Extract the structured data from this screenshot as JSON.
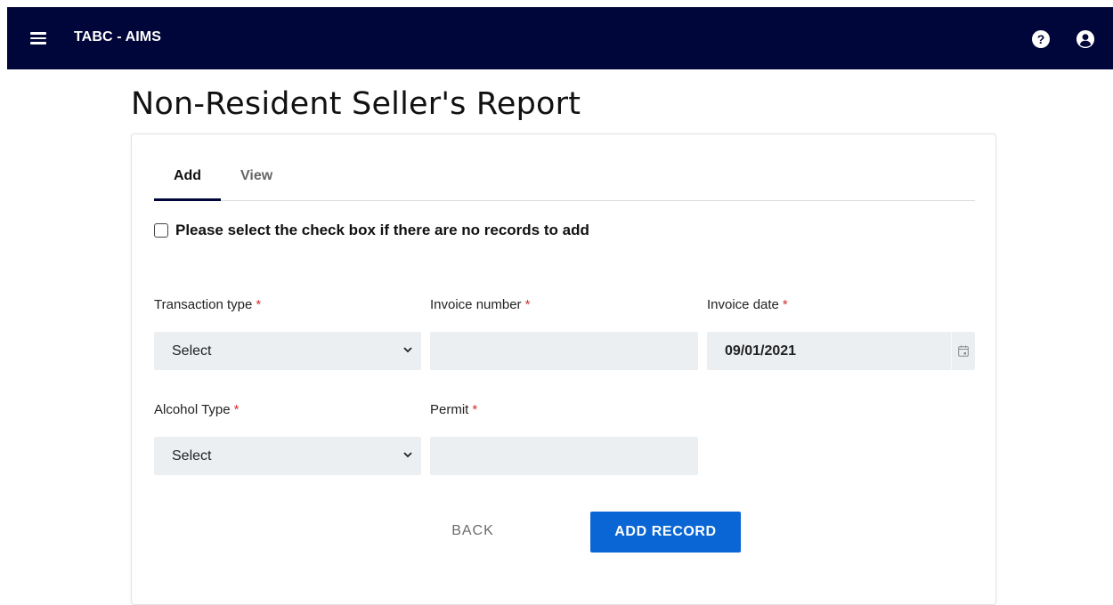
{
  "header": {
    "app_title": "TABC - AIMS",
    "icons": [
      "menu-icon",
      "help-icon",
      "user-account-icon"
    ],
    "background_color": "#00053a"
  },
  "page": {
    "title": "Non-Resident Seller's Report"
  },
  "tabs": [
    {
      "label": "Add",
      "active": true
    },
    {
      "label": "View",
      "active": false
    }
  ],
  "no_records": {
    "label": "Please select the check box if there are no records to add",
    "checked": false
  },
  "form": {
    "transaction_type": {
      "label": "Transaction type",
      "required_mark": "*",
      "value": "Select"
    },
    "invoice_number": {
      "label": "Invoice number",
      "required_mark": "*",
      "value": ""
    },
    "invoice_date": {
      "label": "Invoice date",
      "required_mark": "*",
      "value": "09/01/2021"
    },
    "alcohol_type": {
      "label": "Alcohol Type",
      "required_mark": "*",
      "value": "Select"
    },
    "permit": {
      "label": "Permit",
      "required_mark": "*",
      "value": ""
    }
  },
  "actions": {
    "back_label": "BACK",
    "add_record_label": "ADD RECORD",
    "primary_color": "#0a66d4"
  }
}
